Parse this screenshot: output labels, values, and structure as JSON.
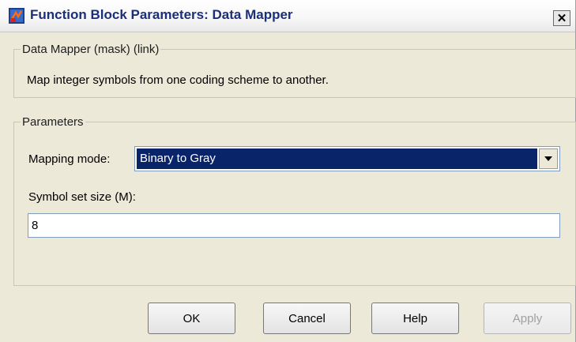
{
  "window": {
    "title": "Function Block Parameters: Data Mapper",
    "close_glyph": "✕"
  },
  "mask": {
    "legend": "Data Mapper (mask) (link)",
    "description": "Map integer symbols from one coding scheme to another."
  },
  "parameters": {
    "legend": "Parameters",
    "mapping_mode_label": "Mapping mode:",
    "mapping_mode_value": "Binary to Gray",
    "symbol_set_size_label": "Symbol set size (M):",
    "symbol_set_size_value": "8"
  },
  "buttons": {
    "ok": "OK",
    "cancel": "Cancel",
    "help": "Help",
    "apply": "Apply"
  },
  "icons": {
    "app": "simulink-block-icon",
    "close": "close-icon",
    "dropdown": "chevron-down-icon"
  }
}
